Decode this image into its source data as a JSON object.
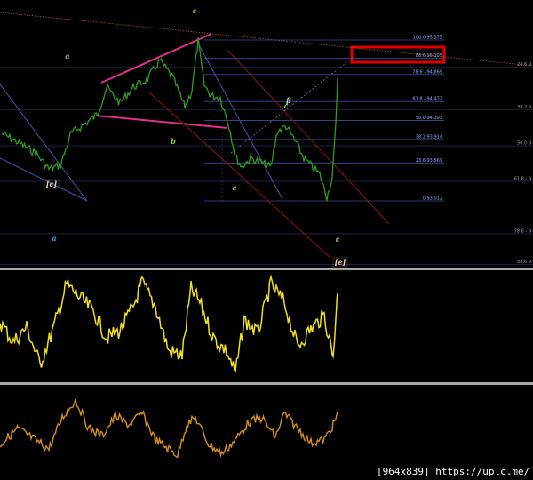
{
  "chart_data": {
    "type": "line",
    "price_series_color": "#2e9e1e",
    "indicator1_color": "#f0e020",
    "indicator2_color": "#d8901c",
    "fib_color": "#3a4ea0",
    "channel_color": "#8a1a10",
    "highlight_color": "#e00000",
    "fib_levels": [
      {
        "label": "100.0 95.375",
        "price": 95.375
      },
      {
        "label": "88.6 95.105",
        "price": 95.105,
        "highlighted": true
      },
      {
        "label": "78.6 - 94.869",
        "price": 94.869
      },
      {
        "label": "61.8 - 94.472",
        "price": 94.472
      },
      {
        "label": "50.0 94.193",
        "price": 94.193
      },
      {
        "label": "38.2 93.914",
        "price": 93.914
      },
      {
        "label": "23.6 93.569",
        "price": 93.569
      },
      {
        "label": "0 93.012",
        "price": 93.012
      }
    ],
    "side_levels": [
      {
        "label": "23.6 9",
        "price": 94.98
      },
      {
        "label": "38.2 9",
        "price": 94.35
      },
      {
        "label": "50.0 9",
        "price": 93.82
      },
      {
        "label": "61.8 - 9",
        "price": 93.3
      },
      {
        "label": "78.6 - 9",
        "price": 92.53
      },
      {
        "label": "88.6 9",
        "price": 92.08
      }
    ],
    "wave_labels": [
      {
        "text": "c",
        "color": "#8fd040"
      },
      {
        "text": "a",
        "color": "#8fd040"
      },
      {
        "text": "b",
        "color": "#8fd040"
      },
      {
        "text": "c",
        "color": "#8fd040"
      },
      {
        "text": "a",
        "color": "#8fd040"
      },
      {
        "text": "[c]",
        "color": "#e8d8b8"
      },
      {
        "text": "a",
        "color": "#30a8e8"
      },
      {
        "text": "c",
        "color": "#8fd040"
      },
      {
        "text": "[e]",
        "color": "#e8d8b8"
      },
      {
        "text": "β",
        "color": "#d0e0a0"
      }
    ]
  },
  "footer": {
    "text": "[964x839] https://uplc.me/"
  }
}
